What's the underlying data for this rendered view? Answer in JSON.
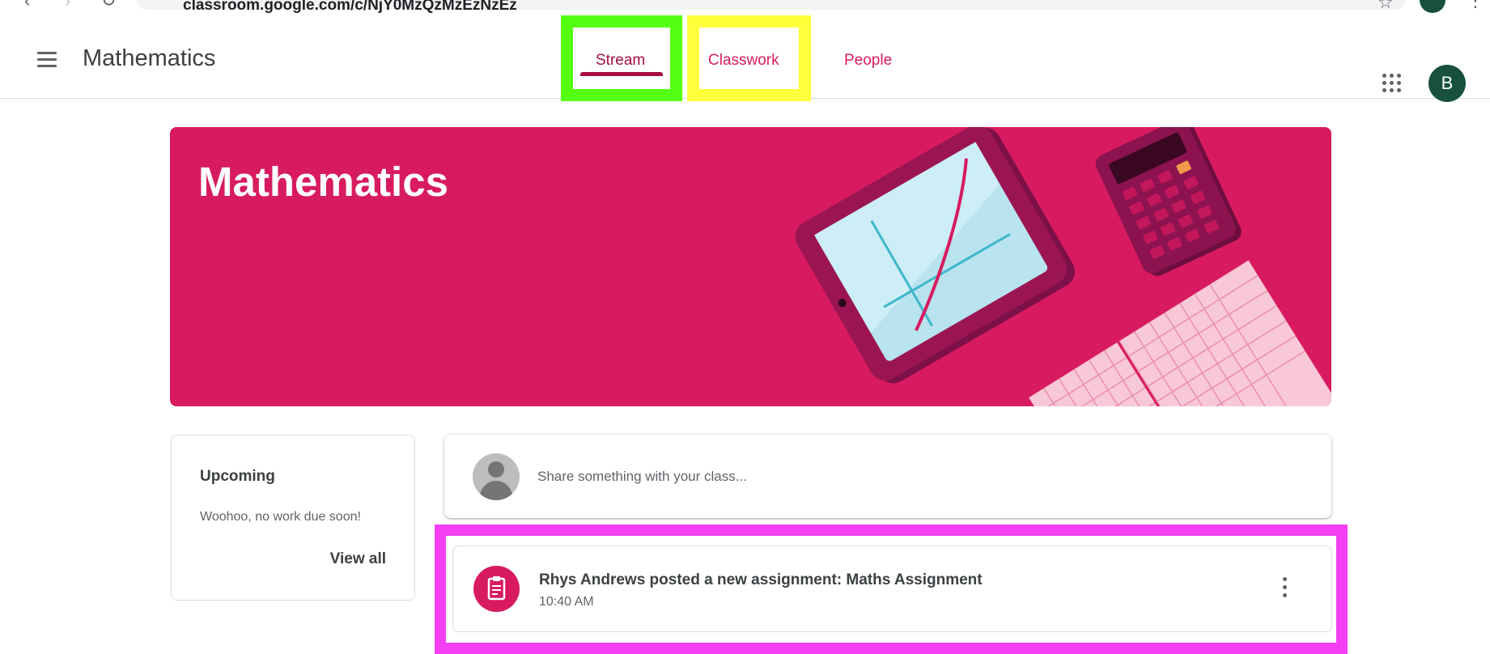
{
  "browser": {
    "url_fragment": "classroom.google.com/c/NjY0MzQzMzEzNzEz",
    "icons": [
      "back-icon",
      "forward-icon",
      "reload-icon",
      "site-info-icon",
      "bookmark-star-icon",
      "profile-avatar",
      "browser-menu-icon"
    ]
  },
  "header": {
    "menu_icon": "hamburger-menu-icon",
    "class_title": "Mathematics",
    "tabs": [
      {
        "label": "Stream",
        "active": true
      },
      {
        "label": "Classwork",
        "active": false
      },
      {
        "label": "People",
        "active": false
      }
    ],
    "apps_icon": "google-apps-icon",
    "account_initial": "B"
  },
  "banner": {
    "title": "Mathematics",
    "illustration": "tablet-graph-calculator-graph-paper"
  },
  "upcoming": {
    "title": "Upcoming",
    "message": "Woohoo, no work due soon!",
    "view_all_label": "View all"
  },
  "share": {
    "placeholder": "Share something with your class..."
  },
  "stream": {
    "items": [
      {
        "icon": "assignment-icon",
        "title": "Rhys Andrews posted a new assignment: Maths Assignment",
        "time": "10:40 AM",
        "menu_icon": "more-vert-icon"
      }
    ]
  },
  "annotations": {
    "highlight_colors": {
      "stream_tab": "#55ff11",
      "classwork_tab": "#ffff3b",
      "assignment_post": "#f33ef3"
    }
  },
  "colors": {
    "accent": "#d81b60",
    "active_tab": "#a50e3f",
    "avatar": "#17503f"
  }
}
